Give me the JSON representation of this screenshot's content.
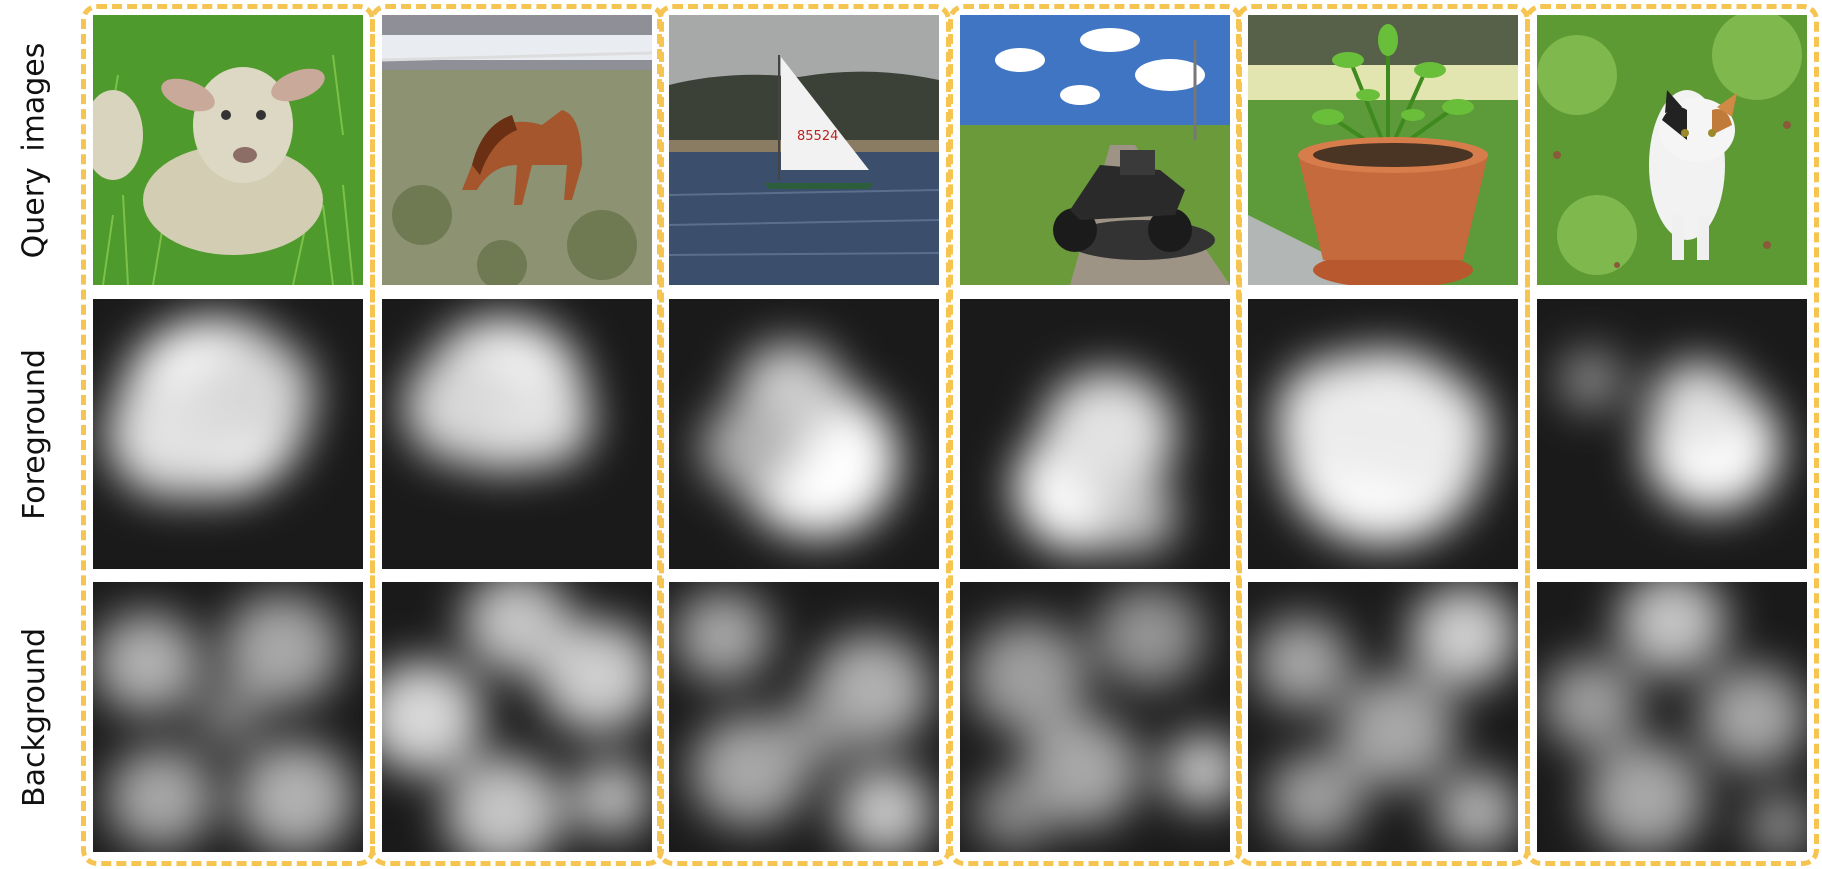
{
  "figure": {
    "row_labels": [
      "Query images",
      "Foreground",
      "Background"
    ],
    "frame_color": "#f5c451",
    "columns": [
      {
        "subject": "lamb-lying-in-grass"
      },
      {
        "subject": "horse-grazing"
      },
      {
        "subject": "sailboat-on-water",
        "sail_text": "85524"
      },
      {
        "subject": "motorcycle-on-road"
      },
      {
        "subject": "potted-plant"
      },
      {
        "subject": "cat-walking-on-grass"
      }
    ]
  }
}
